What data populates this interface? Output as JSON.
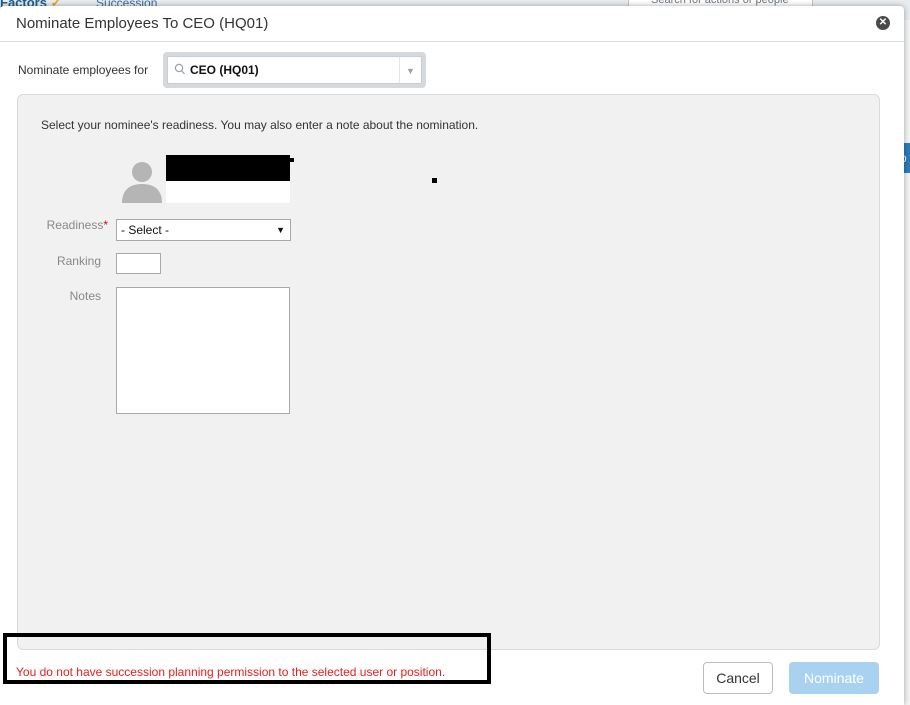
{
  "background": {
    "logo": "Factors",
    "module": "Succession",
    "search_placeholder": "Search for actions or people"
  },
  "dialog": {
    "title": "Nominate Employees To CEO (HQ01)",
    "close_icon": "close-icon"
  },
  "nominate_for": {
    "label": "Nominate employees for",
    "value": "CEO (HQ01)"
  },
  "panel": {
    "instructions": "Select your nominee's readiness. You may also enter a note about the nomination.",
    "readiness_label": "Readiness",
    "readiness_required": "*",
    "readiness_value": "- Select -",
    "ranking_label": "Ranking",
    "notes_label": "Notes"
  },
  "footer": {
    "error_message": "You do not have succession planning permission to the selected user or position.",
    "cancel_label": "Cancel",
    "nominate_label": "Nominate"
  },
  "colors": {
    "error": "#e02020",
    "primary_disabled": "#a8d2f0",
    "panel_bg": "#f1f1f1"
  }
}
